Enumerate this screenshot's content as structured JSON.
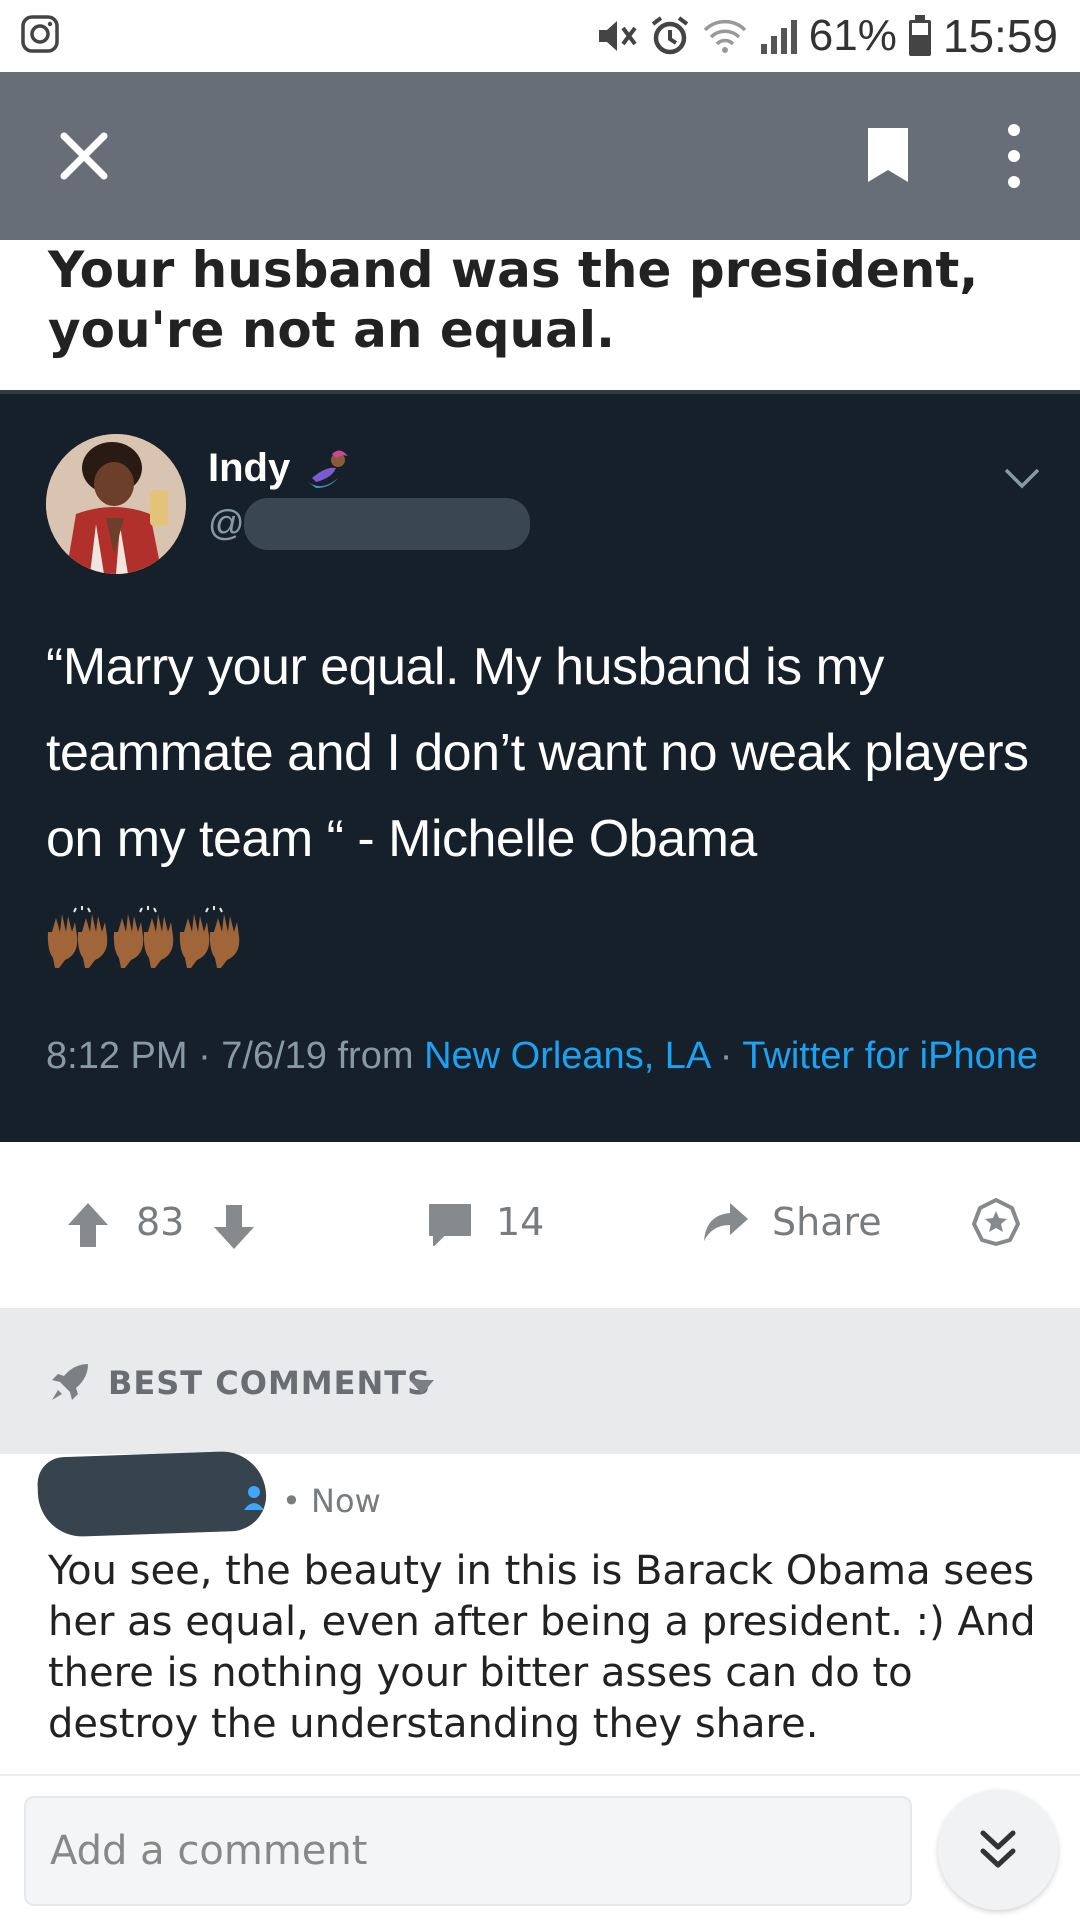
{
  "status_bar": {
    "battery_percent": "61%",
    "time": "15:59",
    "icons": [
      "instagram-icon",
      "mute-icon",
      "alarm-icon",
      "wifi-icon",
      "signal-icon",
      "battery-icon"
    ]
  },
  "toolbar": {
    "background": "#676e78",
    "icons": [
      "close-icon",
      "bookmark-icon",
      "more-icon"
    ]
  },
  "post": {
    "title": "Your husband was the president, you're not an equal."
  },
  "tweet": {
    "name": "Indy",
    "handle_prefix": "@",
    "text": "“Marry your equal. My husband is my teammate and I don’t want no weak players on my team “ - Michelle Obama",
    "emoji": "🙌🏾🙌🏾🙌🏾",
    "meta_prefix": "8:12 PM · 7/6/19 from ",
    "location": "New Orleans, LA",
    "separator": " · ",
    "source": "Twitter for iPhone",
    "colors": {
      "background": "#15202b",
      "link": "#1da1f2",
      "muted": "#8899a6"
    }
  },
  "actions": {
    "score": "83",
    "comment_count": "14",
    "share_label": "Share"
  },
  "comments_section": {
    "sort_label": "BEST COMMENTS"
  },
  "comment": {
    "time": "• Now",
    "body": "You see, the beauty in this is Barack Obama sees her as equal, even after being a president. :) And there is nothing your bitter asses can do to destroy the understanding they share."
  },
  "bottom": {
    "placeholder": "Add a comment"
  }
}
